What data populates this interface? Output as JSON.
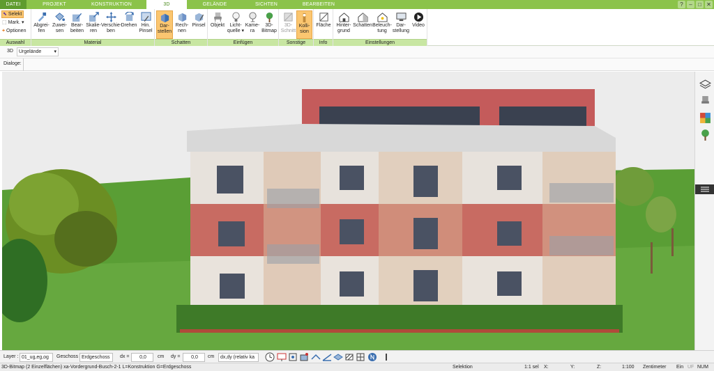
{
  "tabs": [
    {
      "label": "DATEI"
    },
    {
      "label": "PROJEKT"
    },
    {
      "label": "KONSTRUKTION"
    },
    {
      "label": "3D"
    },
    {
      "label": "GELÄNDE"
    },
    {
      "label": "SICHTEN"
    },
    {
      "label": "BEARBEITEN"
    }
  ],
  "window_controls": [
    "?",
    "–",
    "□",
    "✕"
  ],
  "ribbon": {
    "auswahl": {
      "label": "Auswahl",
      "selekt": "Selekt",
      "mark": "Mark.",
      "optionen": "Optionen"
    },
    "material": {
      "label": "Material",
      "buttons": [
        {
          "label": "Abgrei-\nfen",
          "icon": "eyedropper-icon"
        },
        {
          "label": "Zuwei-\nsen",
          "icon": "paint-bucket-icon"
        },
        {
          "label": "Bear-\nbeiten",
          "icon": "edit-material-icon"
        },
        {
          "label": "Skalie-\nren",
          "icon": "scale-icon"
        },
        {
          "label": "Verschie-\nben",
          "icon": "move-icon"
        },
        {
          "label": "Drehen",
          "icon": "rotate-icon"
        },
        {
          "label": "Hin.\nPinsel",
          "icon": "background-brush-icon"
        }
      ]
    },
    "schatten": {
      "label": "Schatten",
      "buttons": [
        {
          "label": "Dar-\nstellen",
          "icon": "shadow-display-icon",
          "active": true
        },
        {
          "label": "Rech-\nnen",
          "icon": "shadow-calc-icon"
        },
        {
          "label": "Pinsel",
          "icon": "shadow-brush-icon"
        }
      ]
    },
    "einfuegen": {
      "label": "Einfügen",
      "buttons": [
        {
          "label": "Objekt",
          "icon": "chair-icon"
        },
        {
          "label": "Licht-\nquelle ▾",
          "icon": "lightbulb-icon"
        },
        {
          "label": "Kame-\nra",
          "icon": "camera-icon"
        },
        {
          "label": "3D-\nBitmap",
          "icon": "tree-bitmap-icon"
        }
      ]
    },
    "sonstige": {
      "label": "Sonstige",
      "buttons": [
        {
          "label": "3D-\nSchnitt",
          "icon": "section-cut-icon"
        },
        {
          "label": "Kolli-\nsion",
          "icon": "collision-icon",
          "active": true
        }
      ]
    },
    "info": {
      "label": "Info",
      "buttons": [
        {
          "label": "Fläche",
          "icon": "area-icon"
        }
      ]
    },
    "einstellungen": {
      "label": "Einstellungen",
      "buttons": [
        {
          "label": "Hinter-\ngrund",
          "icon": "background-icon"
        },
        {
          "label": "Schatten",
          "icon": "shadow-house-icon"
        },
        {
          "label": "Beleuch-\ntung",
          "icon": "lighting-icon"
        },
        {
          "label": "Dar-\nstellung",
          "icon": "display-icon"
        },
        {
          "label": "Video",
          "icon": "video-play-icon"
        }
      ]
    }
  },
  "view": {
    "mode": "3D",
    "terrain_select": "Urgelände"
  },
  "dialoge": "Dialoge:",
  "bottombar": {
    "layer_label": "Layer :",
    "layer_value": "01_ug,eg,og",
    "geschoss_label": "Geschoss :",
    "geschoss_value": "Erdgeschoss",
    "dx_label": "dx =",
    "dx_value": "0,0",
    "dy_label": "dy =",
    "dy_value": "0,0",
    "unit": "cm",
    "mode_value": "dx,dy (relativ ka"
  },
  "statusbar": {
    "message": "3D-Bitmap (2 Einzelflächen) xa-Vordergrund-Busch-2-1 L=Konstruktion G=Erdgeschoss",
    "selektion": "Selektion",
    "scale_sel": "1:1 sel",
    "x": "X:",
    "y": "Y:",
    "z": "Z:",
    "ratio": "1:100",
    "unit": "Zentimeter",
    "ein": "Ein",
    "uf": "UF",
    "num": "NUM"
  },
  "colors": {
    "brand_green": "#8bc34a",
    "group_label_bg": "#c8e6a2",
    "active_button": "#fbc670"
  }
}
